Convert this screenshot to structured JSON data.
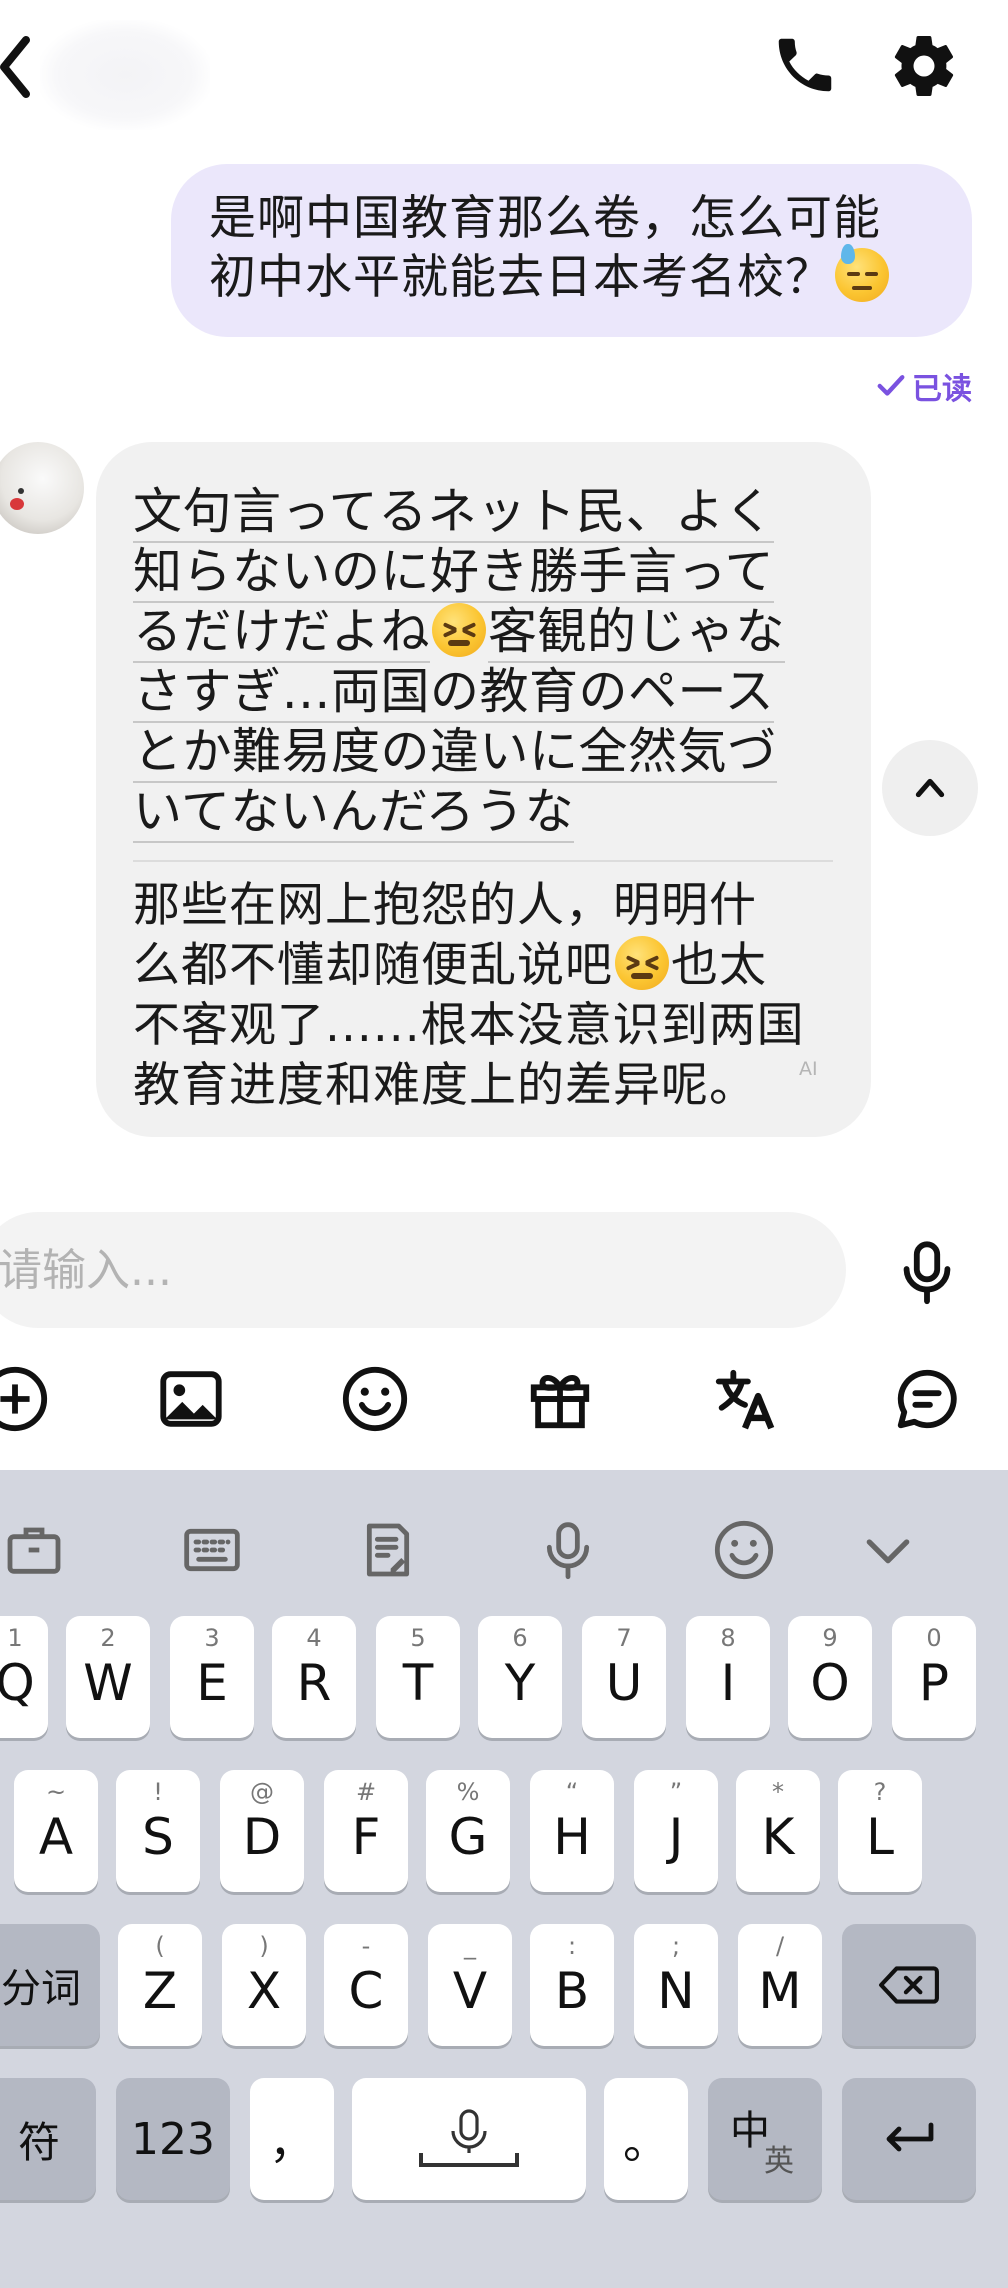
{
  "messages": {
    "sent": {
      "line1": "是啊中国教育那么卷，怎么可能",
      "line2": "初中水平就能去日本考名校？",
      "emoji": "downcast-sweat-emoji"
    },
    "read_status": "已读",
    "received": {
      "original_lines": [
        [
          "文句",
          "言ってる",
          "ネット民、",
          "よく"
        ],
        [
          "知らないのに",
          "好き勝手",
          "言って"
        ],
        [
          "るだけだよね",
          "客観的じゃな"
        ],
        [
          "さすぎ…両国の",
          "教育の",
          "ペース"
        ],
        [
          "とか",
          "難易度の",
          "違いに",
          "全然",
          "気づ"
        ],
        [
          "いてないんだろうな"
        ]
      ],
      "translation_lines": [
        "那些在网上抱怨的人，明明什",
        "么都不懂却随便乱说吧",
        "也太",
        "不客观了......根本没意识到两国",
        "教育进度和难度上的差异呢。"
      ],
      "ai_tag": "AI",
      "emoji": "persevering-face-emoji"
    }
  },
  "input": {
    "placeholder": "请输入...",
    "value": ""
  },
  "keyboard": {
    "row1": [
      {
        "main": "Q",
        "sub": "1"
      },
      {
        "main": "W",
        "sub": "2"
      },
      {
        "main": "E",
        "sub": "3"
      },
      {
        "main": "R",
        "sub": "4"
      },
      {
        "main": "T",
        "sub": "5"
      },
      {
        "main": "Y",
        "sub": "6"
      },
      {
        "main": "U",
        "sub": "7"
      },
      {
        "main": "I",
        "sub": "8"
      },
      {
        "main": "O",
        "sub": "9"
      },
      {
        "main": "P",
        "sub": "0"
      }
    ],
    "row2": [
      {
        "main": "A",
        "sub": "~"
      },
      {
        "main": "S",
        "sub": "!"
      },
      {
        "main": "D",
        "sub": "@"
      },
      {
        "main": "F",
        "sub": "#"
      },
      {
        "main": "G",
        "sub": "%"
      },
      {
        "main": "H",
        "sub": "“"
      },
      {
        "main": "J",
        "sub": "”"
      },
      {
        "main": "K",
        "sub": "*"
      },
      {
        "main": "L",
        "sub": "?"
      }
    ],
    "row3": [
      {
        "main": "Z",
        "sub": "("
      },
      {
        "main": "X",
        "sub": ")"
      },
      {
        "main": "C",
        "sub": "-"
      },
      {
        "main": "V",
        "sub": "_"
      },
      {
        "main": "B",
        "sub": ":"
      },
      {
        "main": "N",
        "sub": ";"
      },
      {
        "main": "M",
        "sub": "/"
      }
    ],
    "segment_key": "分词",
    "symbol_key": "符",
    "numbers_key": "123",
    "comma_key": "，",
    "period_key": "。",
    "lang_key_main": "中",
    "lang_key_sub": "英"
  },
  "colors": {
    "sent_bubble": "#ebe7fb",
    "received_bubble": "#f1f1f1",
    "read_accent": "#7a52e0",
    "keyboard_bg": "#d3d6df"
  }
}
